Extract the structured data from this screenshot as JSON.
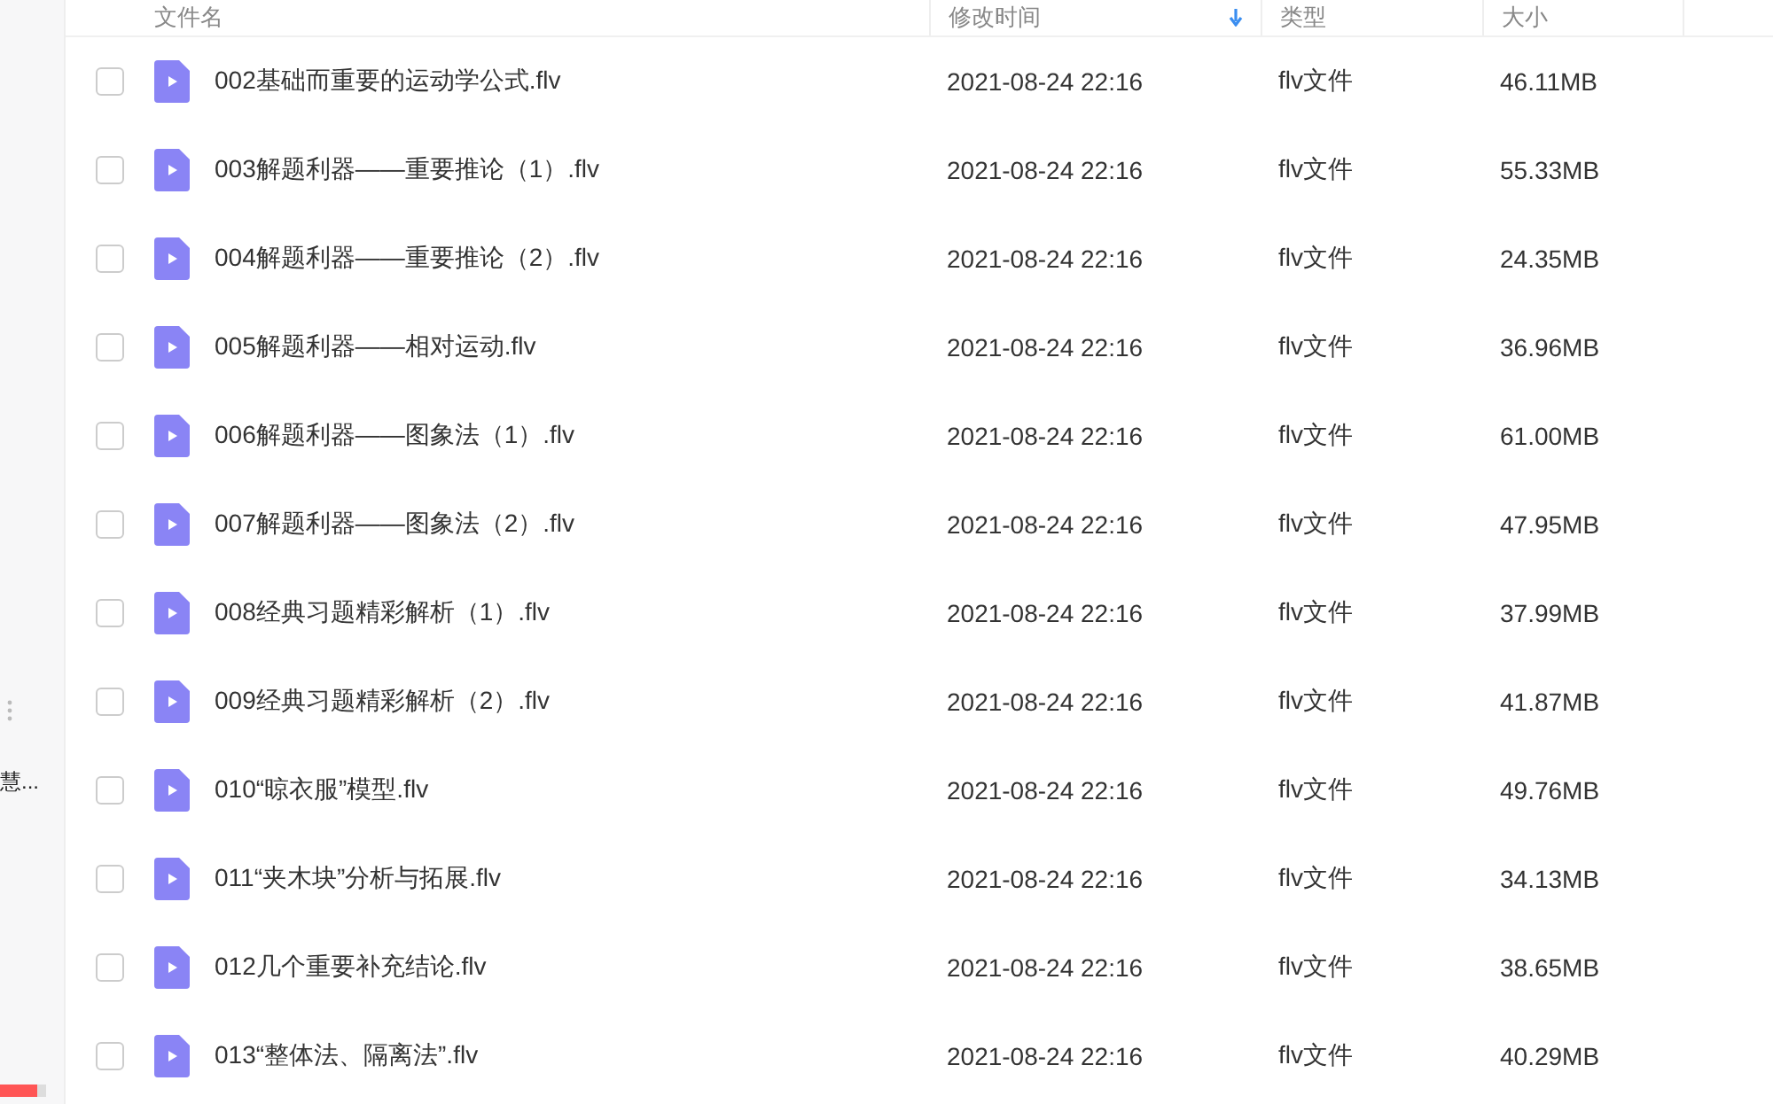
{
  "sidebar": {
    "label": "慧...",
    "storage": {
      "level": 0.8
    }
  },
  "table": {
    "columns": [
      {
        "label": "文件名",
        "sorted": false
      },
      {
        "label": "修改时间",
        "sorted": true
      },
      {
        "label": "类型",
        "sorted": false
      },
      {
        "label": "大小",
        "sorted": false
      }
    ],
    "rows": [
      {
        "name": "002基础而重要的运动学公式.flv",
        "modified": "2021-08-24 22:16",
        "type": "flv文件",
        "size": "46.11MB",
        "checked": false
      },
      {
        "name": "003解题利器——重要推论（1）.flv",
        "modified": "2021-08-24 22:16",
        "type": "flv文件",
        "size": "55.33MB",
        "checked": false
      },
      {
        "name": "004解题利器——重要推论（2）.flv",
        "modified": "2021-08-24 22:16",
        "type": "flv文件",
        "size": "24.35MB",
        "checked": false
      },
      {
        "name": "005解题利器——相对运动.flv",
        "modified": "2021-08-24 22:16",
        "type": "flv文件",
        "size": "36.96MB",
        "checked": false
      },
      {
        "name": "006解题利器——图象法（1）.flv",
        "modified": "2021-08-24 22:16",
        "type": "flv文件",
        "size": "61.00MB",
        "checked": false
      },
      {
        "name": "007解题利器——图象法（2）.flv",
        "modified": "2021-08-24 22:16",
        "type": "flv文件",
        "size": "47.95MB",
        "checked": false
      },
      {
        "name": "008经典习题精彩解析（1）.flv",
        "modified": "2021-08-24 22:16",
        "type": "flv文件",
        "size": "37.99MB",
        "checked": false
      },
      {
        "name": "009经典习题精彩解析（2）.flv",
        "modified": "2021-08-24 22:16",
        "type": "flv文件",
        "size": "41.87MB",
        "checked": false
      },
      {
        "name": "010“晾衣服”模型.flv",
        "modified": "2021-08-24 22:16",
        "type": "flv文件",
        "size": "49.76MB",
        "checked": false
      },
      {
        "name": "011“夹木块”分析与拓展.flv",
        "modified": "2021-08-24 22:16",
        "type": "flv文件",
        "size": "34.13MB",
        "checked": false
      },
      {
        "name": "012几个重要补充结论.flv",
        "modified": "2021-08-24 22:16",
        "type": "flv文件",
        "size": "38.65MB",
        "checked": false
      },
      {
        "name": "013“整体法、隔离法”.flv",
        "modified": "2021-08-24 22:16",
        "type": "flv文件",
        "size": "40.29MB",
        "checked": false
      }
    ]
  }
}
